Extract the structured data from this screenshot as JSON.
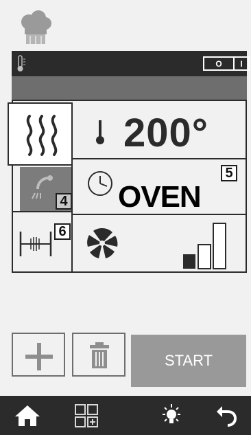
{
  "colors": {
    "dark": "#2b2b2b",
    "panel_gray": "#6e6e6e",
    "start_button": "#999999",
    "background": "#f1f1f1"
  },
  "header": {
    "app_icon": "chef-hat-icon"
  },
  "status_bar": {
    "thermometer_icon": "thermometer-icon",
    "toggle": {
      "off_label": "O",
      "on_label": "I"
    }
  },
  "program": {
    "heat_mode": {
      "icon": "convection-heat-icon",
      "selected": true
    },
    "temperature": {
      "icon": "thermometer-icon",
      "value": "200°"
    },
    "steam": {
      "icon": "steam-nozzle-icon",
      "level": "4"
    },
    "time": {
      "icon": "clock-icon",
      "value": "OVEN",
      "level": "5"
    },
    "rack": {
      "icon": "rack-icon",
      "level": "6"
    },
    "fan": {
      "icon": "fan-icon",
      "speed_levels": 3,
      "speed_selected": 1
    }
  },
  "actions": {
    "add_icon": "plus-icon",
    "delete_icon": "trash-icon",
    "start_label": "START"
  },
  "nav": {
    "items": [
      "home-icon",
      "grid-add-icon",
      "light-bulb-icon",
      "back-arrow-icon"
    ]
  }
}
